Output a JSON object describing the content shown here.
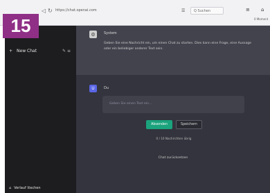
{
  "badge": {
    "number": "15"
  },
  "browser": {
    "nav_back": "◁",
    "nav_reload": "↻",
    "url": "https://chat.openai.com",
    "search_placeholder": "Q Suchen",
    "reader_icon": "☰",
    "menu_label": "≡",
    "extensions_label": "⌂",
    "corner_text": "0 Moment"
  },
  "sidebar": {
    "new_chat_label": "New Chat",
    "new_chat_plus": "+",
    "new_chat_icons": "✎ ≡",
    "bottom_label": "Verlauf löschen",
    "bottom_icon": "⌂"
  },
  "main": {
    "system_avatar": "⚙",
    "system_name": "System",
    "system_text": "Geben Sie eine Nachricht ein, um einen Chat zu starten. Dies kann eine Frage, eine Aussage oder ein beliebiger anderer Text sein.",
    "user_avatar": "U",
    "user_name": "Du",
    "input_placeholder": "Geben Sie einen Text ein...",
    "send_label": "Absenden",
    "save_label": "Speichern",
    "counter_text": "0 / 10 Nachrichten übrig",
    "clear_label": "Chat zurücksetzen"
  },
  "colors": {
    "sidebar_bg": "#1d1d1f",
    "main_bg": "#33343d",
    "system_row_bg": "#42434d",
    "send_button": "#1aa37c",
    "user_avatar": "#5a66e6",
    "badge": "#8f2f86"
  }
}
